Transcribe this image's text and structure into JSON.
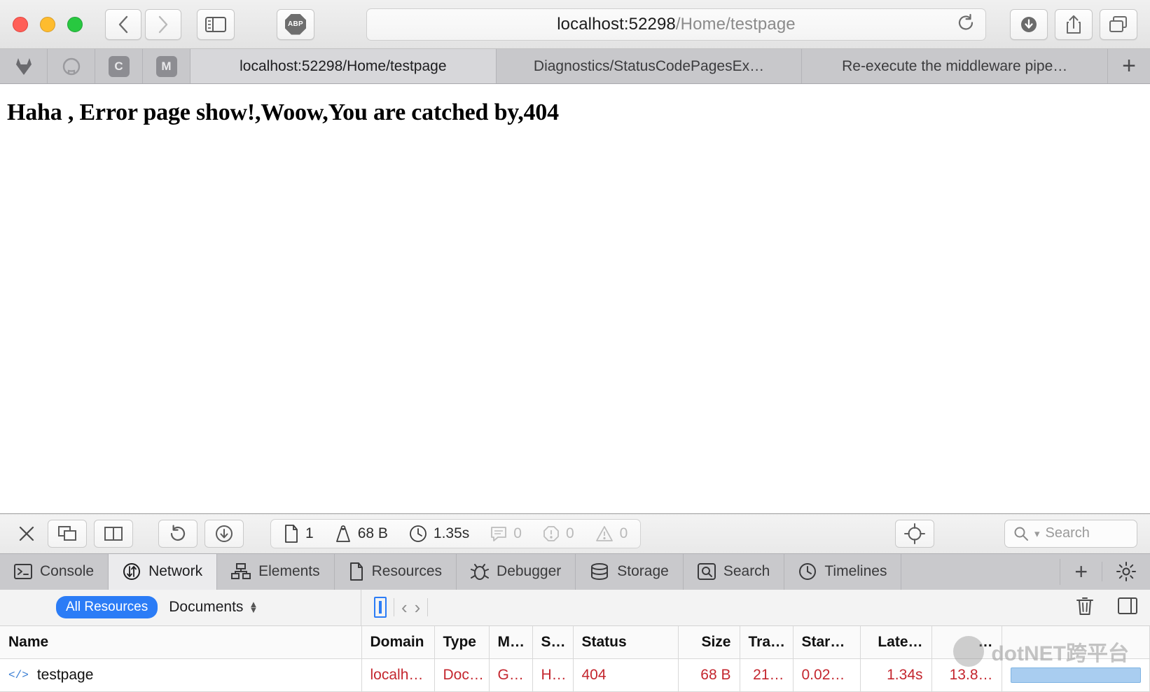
{
  "browser": {
    "window_controls": [
      "close",
      "minimize",
      "zoom"
    ],
    "nav": {
      "back_label": "‹",
      "forward_label": "›"
    },
    "extension_badge": "ABP",
    "url": {
      "host": "localhost:52298",
      "path": "/Home/testpage"
    },
    "favorites": [
      "gitlab-icon",
      "github-icon",
      "C",
      "M"
    ],
    "tabs": [
      {
        "label": "localhost:52298/Home/testpage",
        "active": true
      },
      {
        "label": "Diagnostics/StatusCodePagesEx…",
        "active": false
      },
      {
        "label": "Re-execute the middleware pipe…",
        "active": false
      }
    ],
    "new_tab_label": "+"
  },
  "page": {
    "heading": "Haha , Error page show!,Woow,You are catched by,404"
  },
  "inspector": {
    "stats": [
      {
        "icon": "document-icon",
        "value": "1",
        "dim": false
      },
      {
        "icon": "weight-icon",
        "value": "68 B",
        "dim": false
      },
      {
        "icon": "clock-icon",
        "value": "1.35s",
        "dim": false
      },
      {
        "icon": "message-icon",
        "value": "0",
        "dim": true
      },
      {
        "icon": "error-icon",
        "value": "0",
        "dim": true
      },
      {
        "icon": "warning-icon",
        "value": "0",
        "dim": true
      }
    ],
    "search_placeholder": "Search",
    "tabs": [
      {
        "label": "Console",
        "icon": "console-icon",
        "active": false
      },
      {
        "label": "Network",
        "icon": "network-icon",
        "active": true
      },
      {
        "label": "Elements",
        "icon": "elements-icon",
        "active": false
      },
      {
        "label": "Resources",
        "icon": "resources-icon",
        "active": false
      },
      {
        "label": "Debugger",
        "icon": "debugger-icon",
        "active": false
      },
      {
        "label": "Storage",
        "icon": "storage-icon",
        "active": false
      },
      {
        "label": "Search",
        "icon": "search-icon",
        "active": false
      },
      {
        "label": "Timelines",
        "icon": "timelines-icon",
        "active": false
      }
    ],
    "tab_add_label": "+",
    "filter": {
      "all_resources": "All Resources",
      "type_select": "Documents"
    }
  },
  "network_table": {
    "columns": [
      "Name",
      "Domain",
      "Type",
      "M…",
      "S…",
      "Status",
      "Size",
      "Tra…",
      "Star…",
      "Late…",
      "…",
      ""
    ],
    "rows": [
      {
        "name": "testpage",
        "domain": "localh…",
        "type": "Doc…",
        "method": "G…",
        "scheme": "H…",
        "status": "404",
        "size": "68 B",
        "transferred": "21…",
        "start": "0.02…",
        "latency": "1.34s",
        "duration": "13.8…",
        "waterfall": ""
      }
    ]
  },
  "watermark": {
    "text": "dotNET跨平台"
  },
  "colors": {
    "accent": "#2b7cf6",
    "error": "#c4262e",
    "waterfall": "#a9cdf0"
  }
}
